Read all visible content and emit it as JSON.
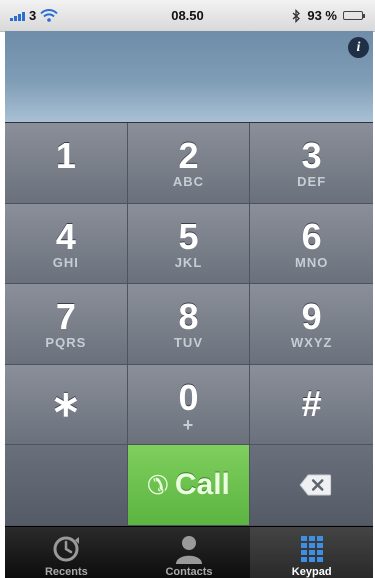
{
  "status_bar": {
    "carrier": "3",
    "time": "08.50",
    "battery": "93 %",
    "battery_level": 0.93
  },
  "display": {
    "info_label": "i"
  },
  "keys": [
    {
      "digit": "1",
      "letters": ""
    },
    {
      "digit": "2",
      "letters": "ABC"
    },
    {
      "digit": "3",
      "letters": "DEF"
    },
    {
      "digit": "4",
      "letters": "GHI"
    },
    {
      "digit": "5",
      "letters": "JKL"
    },
    {
      "digit": "6",
      "letters": "MNO"
    },
    {
      "digit": "7",
      "letters": "PQRS"
    },
    {
      "digit": "8",
      "letters": "TUV"
    },
    {
      "digit": "9",
      "letters": "WXYZ"
    },
    {
      "digit": "∗",
      "letters": ""
    },
    {
      "digit": "0",
      "letters": "+"
    },
    {
      "digit": "#",
      "letters": ""
    }
  ],
  "call": {
    "label": "Call"
  },
  "tabs": [
    {
      "label": "Recents",
      "icon": "clock-icon"
    },
    {
      "label": "Contacts",
      "icon": "person-icon"
    },
    {
      "label": "Keypad",
      "icon": "keypad-grid-icon"
    }
  ],
  "active_tab": "Keypad",
  "colors": {
    "call_green": "#5bb441",
    "battery_green": "#32c53a",
    "signal_blue": "#2a6ed2"
  }
}
